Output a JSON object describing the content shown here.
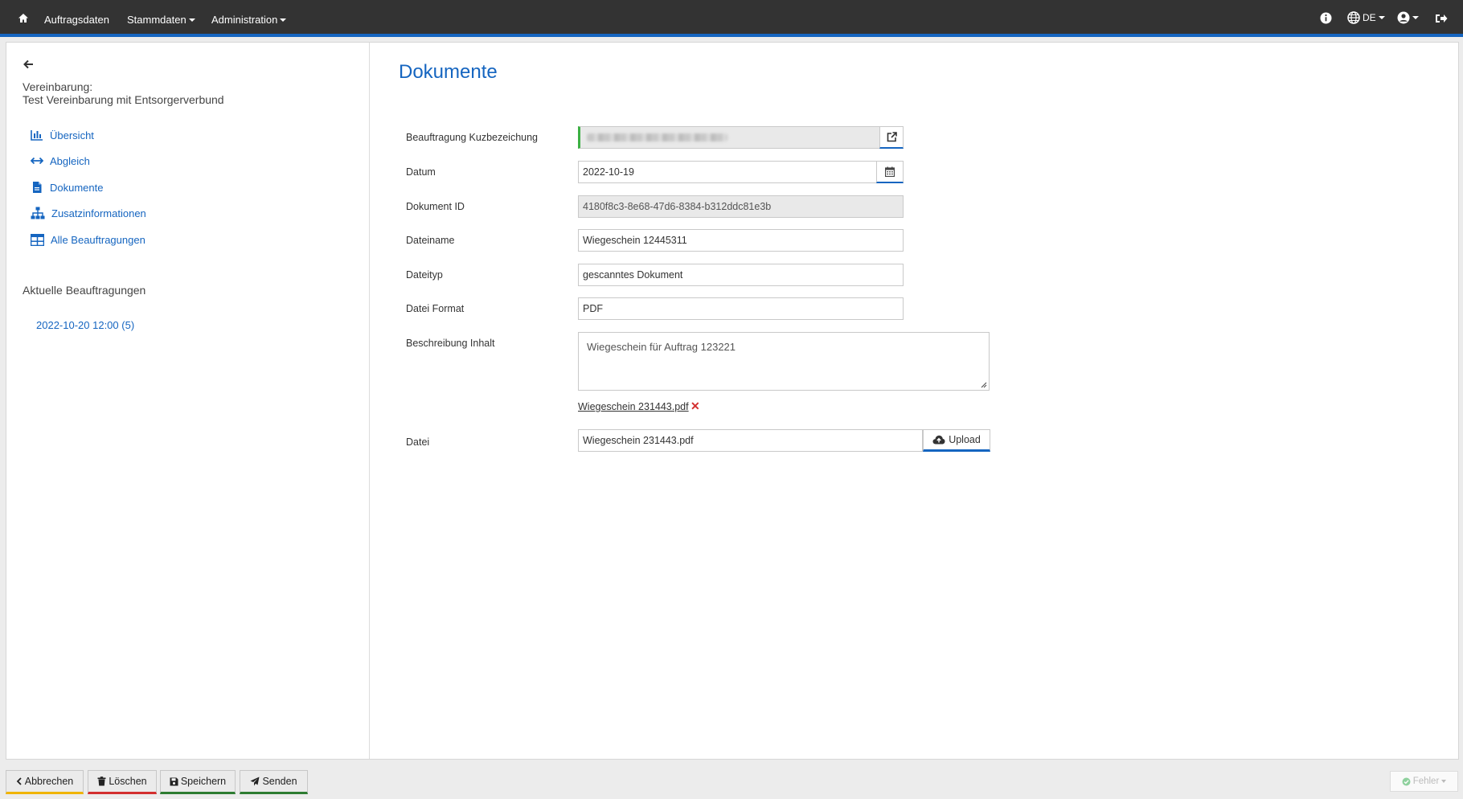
{
  "navbar": {
    "home_icon": "home-icon",
    "items": [
      {
        "label": "Auftragsdaten"
      },
      {
        "label": "Stammdaten"
      },
      {
        "label": "Administration"
      }
    ],
    "right_icons": [
      "info-icon",
      "globe-icon",
      "user-icon",
      "logout-icon"
    ],
    "language": "DE",
    "accent_color": "#1565c0",
    "background_color": "#333333"
  },
  "sidebar": {
    "agreement_label": "Vereinbarung:",
    "agreement_name": "Test Vereinbarung mit Entsorgerverbund",
    "links": [
      {
        "label": "Übersicht",
        "icon": "bar-chart-icon"
      },
      {
        "label": "Abgleich",
        "icon": "arrows-horizontal-icon"
      },
      {
        "label": "Dokumente",
        "icon": "file-icon"
      },
      {
        "label": "Zusatzinformationen",
        "icon": "sitemap-icon"
      },
      {
        "label": "Alle Beauftragungen",
        "icon": "table-icon"
      }
    ],
    "current_title": "Aktuelle Beauftragungen",
    "current_items": [
      {
        "label": "2022-10-20 12:00 (5)"
      }
    ]
  },
  "form": {
    "title": "Dokumente",
    "fields": {
      "beauftragung": {
        "label": "Beauftragung Kuzbezeichung"
      },
      "datum": {
        "label": "Datum",
        "value": "2022-10-19"
      },
      "dokument_id": {
        "label": "Dokument ID",
        "value": "4180f8c3-8e68-47d6-8384-b312ddc81e3b"
      },
      "dateiname": {
        "label": "Dateiname",
        "value": "Wiegeschein 12445311"
      },
      "dateityp": {
        "label": "Dateityp",
        "value": "gescanntes Dokument"
      },
      "datei_format": {
        "label": "Datei Format",
        "value": "PDF"
      },
      "beschreibung": {
        "label": "Beschreibung Inhalt",
        "value": "Wiegeschein für Auftrag 123221"
      },
      "datei": {
        "label": "Datei",
        "value": "Wiegeschein 231443.pdf",
        "attached_file": "Wiegeschein 231443.pdf",
        "upload_label": "Upload"
      }
    }
  },
  "footer": {
    "buttons": [
      {
        "label": "Abbrechen",
        "accent": "#f0b400"
      },
      {
        "label": "Löschen",
        "accent": "#d32f2f"
      },
      {
        "label": "Speichern",
        "accent": "#2e7d32"
      },
      {
        "label": "Senden",
        "accent": "#2e7d32"
      }
    ],
    "status_label": "Fehler"
  }
}
